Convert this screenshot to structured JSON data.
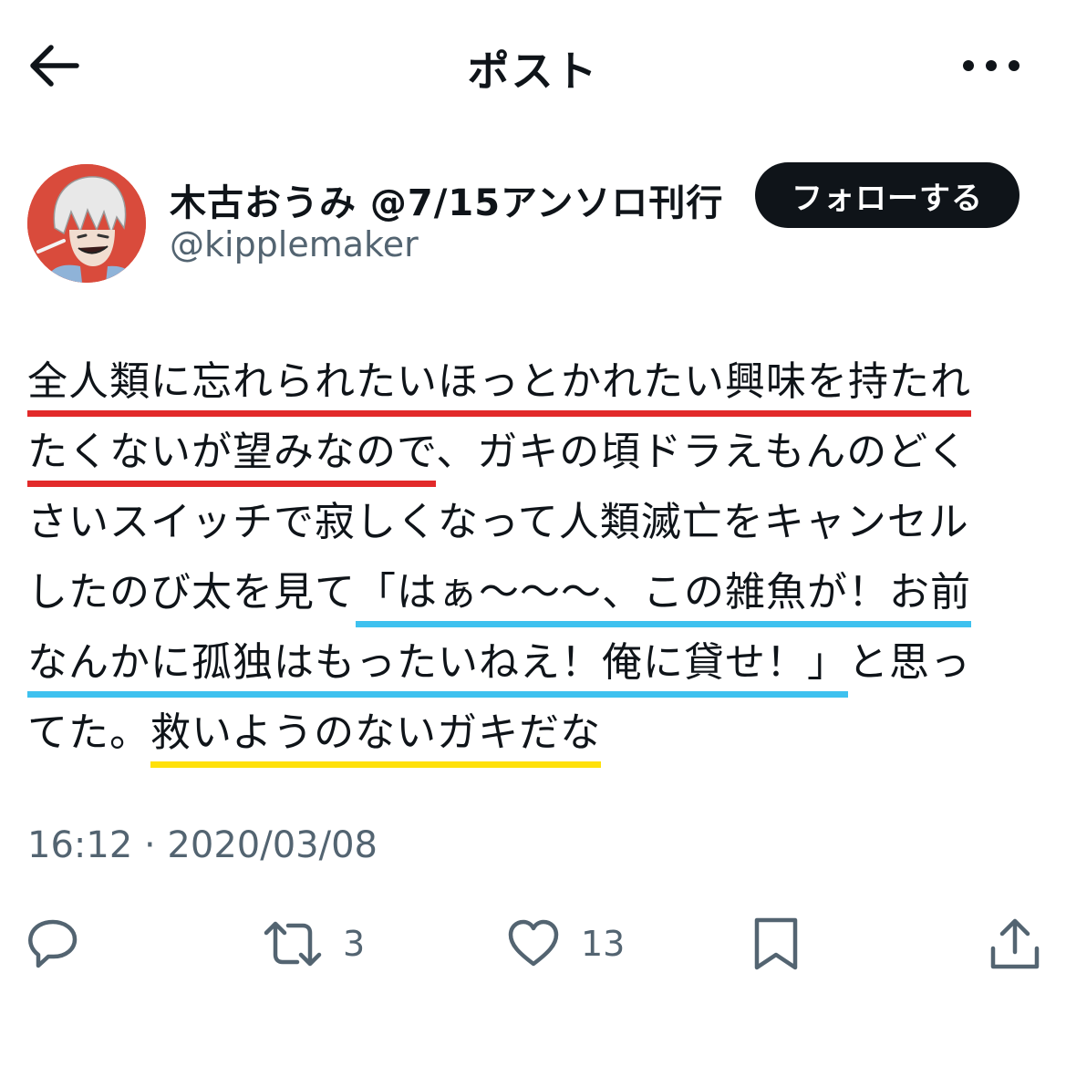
{
  "header": {
    "title": "ポスト",
    "back_icon": "arrow-left-icon",
    "more_icon": "more-horizontal-icon"
  },
  "author": {
    "display_name": "木古おうみ @7/15アンソロ刊行",
    "handle": "@kipplemaker",
    "follow_label": "フォローする",
    "avatar_bg": "#d94b3c"
  },
  "tweet": {
    "lines": [
      {
        "segments": [
          {
            "text": "全人類に忘れられたいほっとかれたい興味を持たれ",
            "highlight": "red"
          }
        ]
      },
      {
        "segments": [
          {
            "text": "たくないが望みなので",
            "highlight": "red"
          },
          {
            "text": "、ガキの頃ドラえもんのどく",
            "highlight": ""
          }
        ]
      },
      {
        "segments": [
          {
            "text": "さいスイッチで寂しくなって人類滅亡をキャンセル",
            "highlight": ""
          }
        ]
      },
      {
        "segments": [
          {
            "text": "したのび太を見て",
            "highlight": ""
          },
          {
            "text": "「はぁ〜〜〜、この雑魚が！お前",
            "highlight": "blue"
          }
        ]
      },
      {
        "segments": [
          {
            "text": "なんかに孤独はもったいねえ！俺に貸せ！」",
            "highlight": "blue"
          },
          {
            "text": "と思っ",
            "highlight": ""
          }
        ]
      },
      {
        "segments": [
          {
            "text": "てた。",
            "highlight": ""
          },
          {
            "text": "救いようのないガキだな",
            "highlight": "yellow"
          }
        ]
      }
    ],
    "highlight_colors": {
      "red": "#e22a2a",
      "blue": "#3ec1ef",
      "yellow": "#ffe10a"
    }
  },
  "meta": {
    "timestamp": "16:12 · 2020/03/08"
  },
  "actions": {
    "reply": {
      "icon": "reply-icon"
    },
    "retweet": {
      "icon": "retweet-icon",
      "count": "3"
    },
    "like": {
      "icon": "heart-icon",
      "count": "13"
    },
    "bookmark": {
      "icon": "bookmark-icon"
    },
    "share": {
      "icon": "share-icon"
    }
  }
}
